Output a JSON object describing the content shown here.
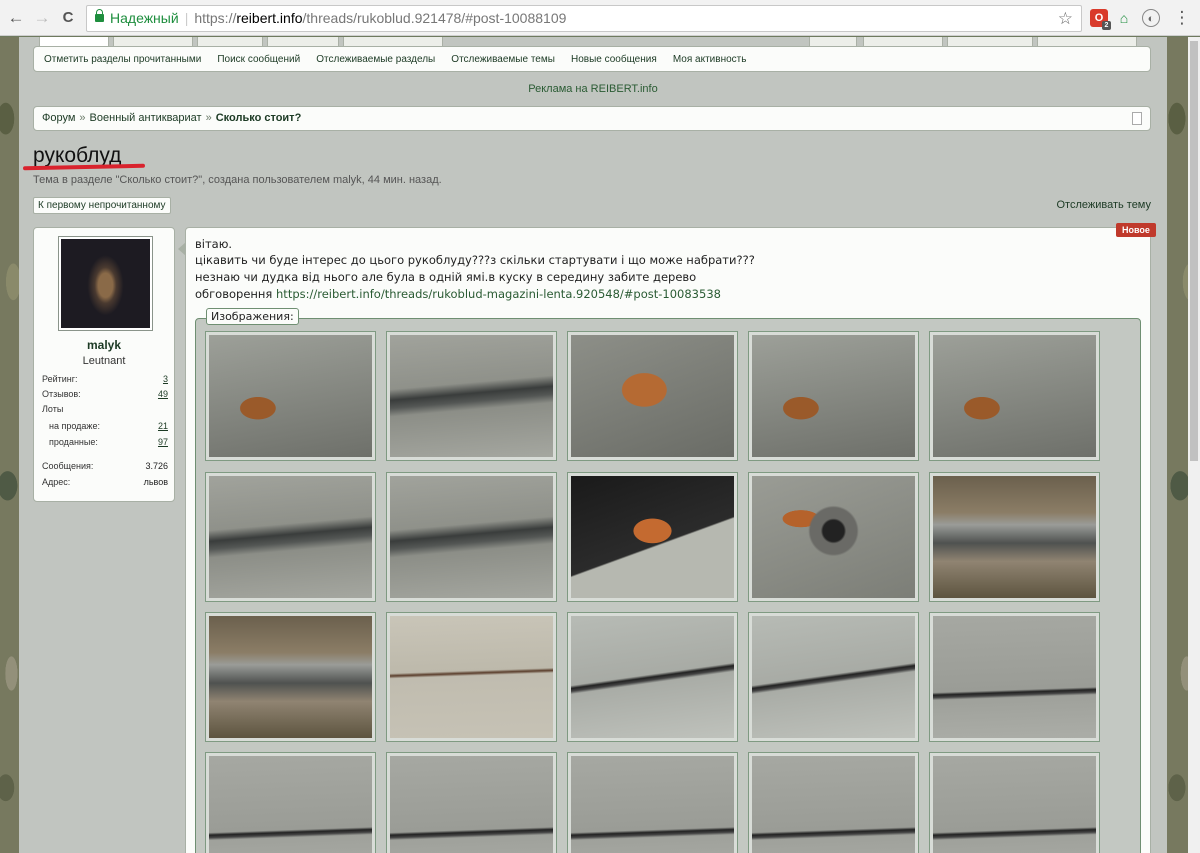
{
  "browser": {
    "back": "←",
    "forward": "→",
    "reload": "C",
    "secure_label": "Надежный",
    "url_scheme": "https://",
    "url_domain": "reibert.info",
    "url_path": "/threads/rukoblud.921478/#post-10088109",
    "star": "☆",
    "menu": "⋮",
    "ext1_badge": "2"
  },
  "subnav": {
    "items": [
      "Отметить разделы прочитанными",
      "Поиск сообщений",
      "Отслеживаемые разделы",
      "Отслеживаемые темы",
      "Новые сообщения",
      "Моя активность"
    ]
  },
  "ad_text": "Реклама на REIBERT.info",
  "breadcrumb": {
    "items": [
      "Форум",
      "Военный антиквариат",
      "Сколько стоит?"
    ],
    "separator": "»"
  },
  "thread": {
    "title": "рукоблуд",
    "subtitle": "Тема в разделе \"Сколько стоит?\", создана пользователем malyk, 44 мин. назад.",
    "first_unread_button": "К первому непрочитанному",
    "watch_link": "Отслеживать тему"
  },
  "user": {
    "name": "malyk",
    "rank": "Leutnant",
    "stats": {
      "rating_label": "Рейтинг:",
      "rating": "3",
      "reviews_label": "Отзывов:",
      "reviews": "49",
      "lots_label": "Лоты",
      "selling_label": "на продаже:",
      "selling": "21",
      "sold_label": "проданные:",
      "sold": "97",
      "messages_label": "Сообщения:",
      "messages": "3.726",
      "address_label": "Адрес:",
      "address": "львов"
    }
  },
  "post": {
    "badge": "Новое",
    "lines": [
      "вітаю.",
      "цікавить чи буде інтерес до цього рукоблуду???з скільки стартувати і що може набрати???",
      "незнаю чи дудка від нього але була в одній ямі.в куску в середину забите дерево"
    ],
    "discussion_label": "обговорення",
    "discussion_link": "https://reibert.info/threads/rukoblud-magazini-lenta.920548/#post-10083538",
    "attachments_legend": "Изображения:",
    "thumbnails": [
      "t-rust",
      "t-steel",
      "t-grip",
      "t-rust",
      "t-rust",
      "t-steel",
      "t-steel",
      "t-shadow",
      "t-muzzle",
      "t-detail",
      "t-detail",
      "t-rod",
      "t-pipe",
      "t-pipe",
      "t-pipe2",
      "t-pipe2",
      "t-pipe2",
      "t-pipe2",
      "t-pipe2",
      "t-pipe2"
    ]
  }
}
